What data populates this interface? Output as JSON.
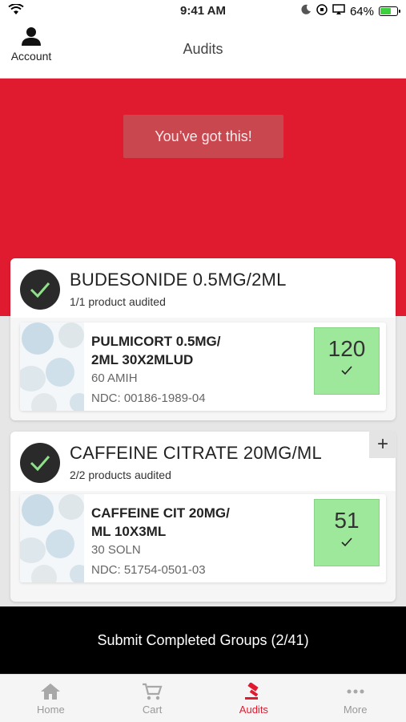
{
  "status_bar": {
    "time": "9:41 AM",
    "battery_percent": "64%",
    "battery_level": 0.64
  },
  "header": {
    "title": "Audits",
    "account_label": "Account"
  },
  "banner": {
    "message": "You’ve got this!"
  },
  "groups": [
    {
      "title": "BUDESONIDE 0.5MG/2ML",
      "subtitle": "1/1 product audited",
      "product": {
        "name": "PULMICORT 0.5MG/ 2ML 30X2MLUD",
        "package": "60 AMIH",
        "ndc": "NDC: 00186-1989-04",
        "count": "120"
      }
    },
    {
      "title": "CAFFEINE CITRATE 20MG/ML",
      "subtitle": "2/2 products audited",
      "product": {
        "name": "CAFFEINE CIT 20MG/ ML 10X3ML",
        "package": "30 SOLN",
        "ndc": "NDC: 51754-0501-03",
        "count": "51"
      }
    }
  ],
  "add_button": "+",
  "submit": {
    "label": "Submit Completed Groups (2/41)"
  },
  "tabs": [
    {
      "label": "Home",
      "icon": "home-icon"
    },
    {
      "label": "Cart",
      "icon": "cart-icon"
    },
    {
      "label": "Audits",
      "icon": "gavel-icon",
      "active": true
    },
    {
      "label": "More",
      "icon": "more-icon"
    }
  ],
  "colors": {
    "accent": "#e01b30",
    "count_bg": "#9de89a",
    "submit_bg": "#000000"
  }
}
